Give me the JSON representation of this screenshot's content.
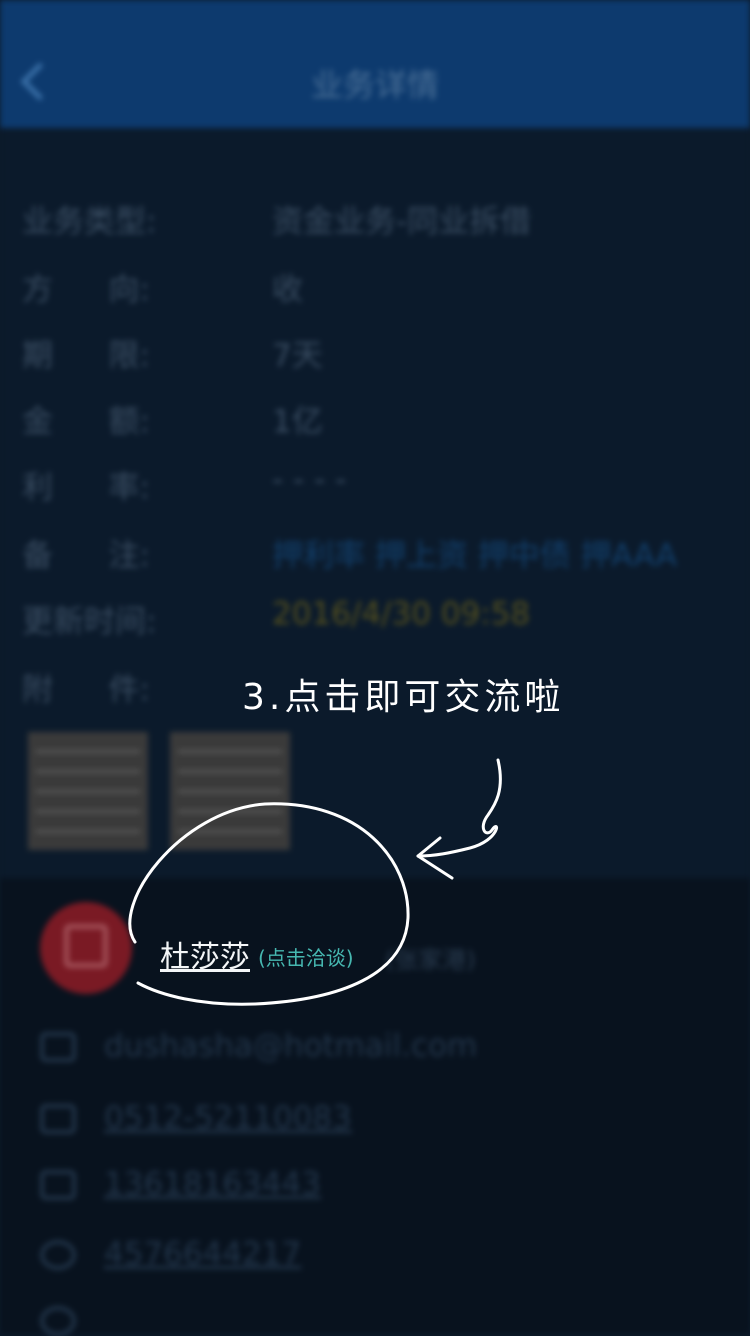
{
  "header": {
    "title": "业务详情"
  },
  "detail": {
    "rows": [
      {
        "label": "业务类型:",
        "value": "资金业务-同业拆借"
      },
      {
        "label_chars": [
          "方",
          "向:"
        ],
        "value": "收"
      },
      {
        "label_chars": [
          "期",
          "限:"
        ],
        "value": "7天"
      },
      {
        "label_chars": [
          "金",
          "额:"
        ],
        "value": "1亿"
      },
      {
        "label_chars": [
          "利",
          "率:"
        ],
        "value": "- - - -"
      },
      {
        "label_chars": [
          "备",
          "注:"
        ],
        "value": "押利率  押上资  押中债  押AAA"
      },
      {
        "label": "更新时间:",
        "value": "2016/4/30 09:58"
      },
      {
        "label_chars": [
          "附",
          "件:"
        ]
      }
    ]
  },
  "contact": {
    "name": "杜莎莎",
    "hint": "(点击洽谈)",
    "company": "(张家港)",
    "email": "dushasha@hotmail.com",
    "tel": "0512-52110083",
    "mobile": "13618163443",
    "qq": "4576644217"
  },
  "tutorial": {
    "step_text": "3.点击即可交流啦"
  },
  "colors": {
    "header": "#0d3a6e",
    "background": "#0b1a2b",
    "hint": "#46b7b0",
    "overlay_text": "#ffffff"
  }
}
